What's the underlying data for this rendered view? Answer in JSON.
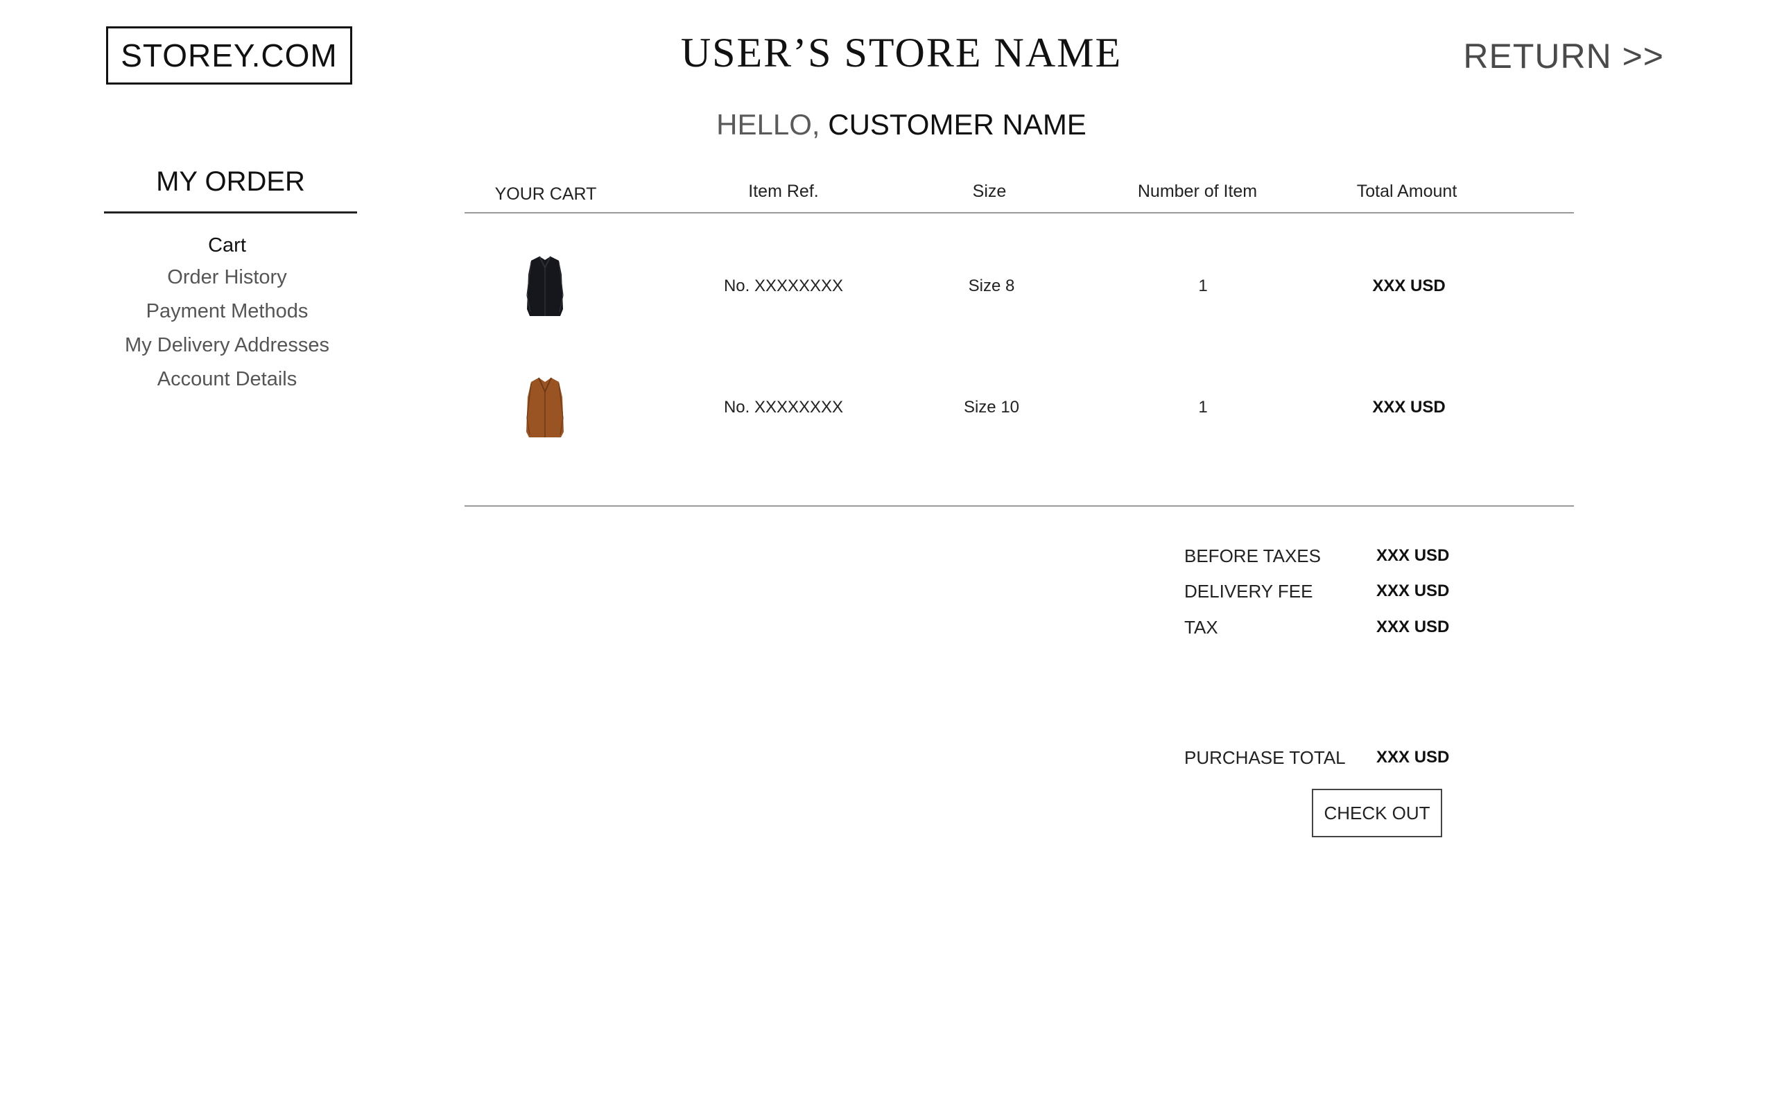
{
  "header": {
    "logo": "STOREY.COM",
    "store_name": "USER’S STORE NAME",
    "return_label": "RETURN >>"
  },
  "greeting": {
    "hello": "HELLO, ",
    "customer_name": "CUSTOMER NAME"
  },
  "sidebar": {
    "title": "MY ORDER",
    "items": [
      {
        "label": "Cart",
        "active": true
      },
      {
        "label": "Order History",
        "active": false
      },
      {
        "label": "Payment Methods",
        "active": false
      },
      {
        "label": "My Delivery Addresses",
        "active": false
      },
      {
        "label": "Account Details",
        "active": false
      }
    ]
  },
  "cart": {
    "columns": [
      "YOUR CART",
      "Item Ref.",
      "Size",
      "Number of Item",
      "Total Amount"
    ],
    "rows": [
      {
        "image": "black-coat",
        "ref": "No. XXXXXXXX",
        "size": "Size 8",
        "qty": "1",
        "amount": "XXX USD"
      },
      {
        "image": "brown-coat",
        "ref": "No. XXXXXXXX",
        "size": "Size 10",
        "qty": "1",
        "amount": "XXX USD"
      }
    ]
  },
  "summary": {
    "before_taxes_label": "BEFORE TAXES",
    "before_taxes_value": "XXX USD",
    "delivery_fee_label": "DELIVERY FEE",
    "delivery_fee_value": "XXX USD",
    "tax_label": "TAX",
    "tax_value": "XXX USD",
    "purchase_total_label": "PURCHASE TOTAL",
    "purchase_total_value": "XXX USD",
    "checkout_label": "CHECK OUT"
  },
  "colors": {
    "black_coat": "#15171c",
    "brown_coat": "#9a5424"
  }
}
